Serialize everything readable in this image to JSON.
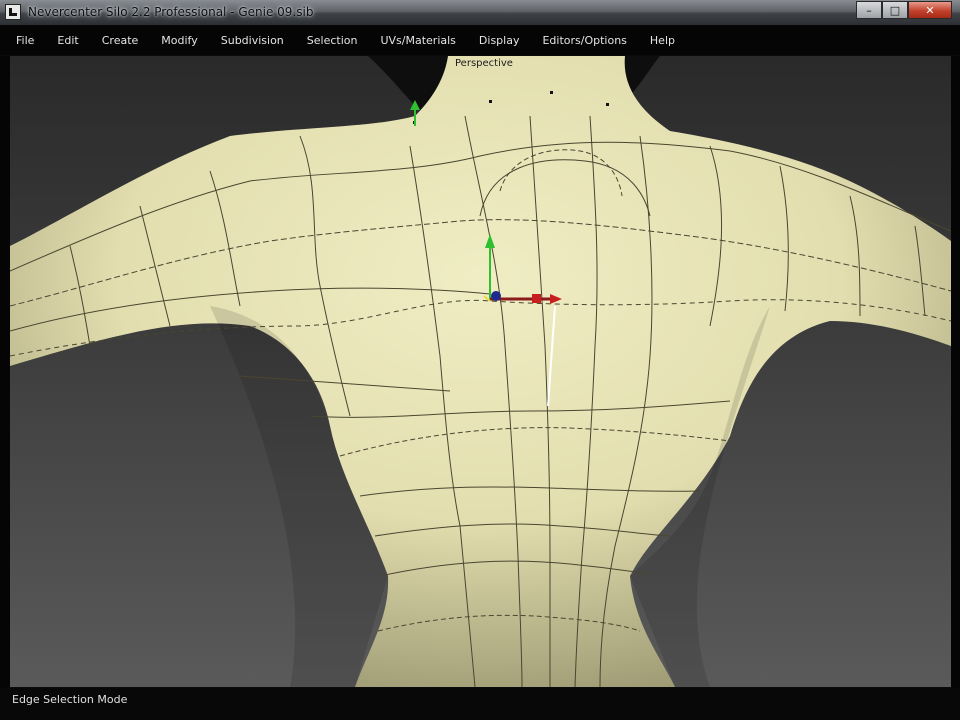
{
  "window": {
    "title": "Nevercenter Silo 2.2 Professional - Genie 09.sib",
    "app_icon": "silo-app-icon",
    "controls": [
      "minimize-icon",
      "maximize-icon",
      "close-icon"
    ]
  },
  "menu": {
    "items": [
      {
        "label": "File"
      },
      {
        "label": "Edit"
      },
      {
        "label": "Create"
      },
      {
        "label": "Modify"
      },
      {
        "label": "Subdivision"
      },
      {
        "label": "Selection"
      },
      {
        "label": "UVs/Materials"
      },
      {
        "label": "Display"
      },
      {
        "label": "Editors/Options"
      },
      {
        "label": "Help"
      }
    ]
  },
  "viewport": {
    "label": "Perspective",
    "model": "humanoid-torso-back",
    "colors": {
      "skin": "#e6e2b4",
      "background_top": "#2a2a2a",
      "background_bottom": "#5a5a5a",
      "edge_lines": "#4a4630",
      "gizmo_x": "#c81e1e",
      "gizmo_y": "#2ec02e",
      "gizmo_z": "#1e2a8c"
    }
  },
  "status": {
    "mode": "Edge Selection Mode"
  }
}
